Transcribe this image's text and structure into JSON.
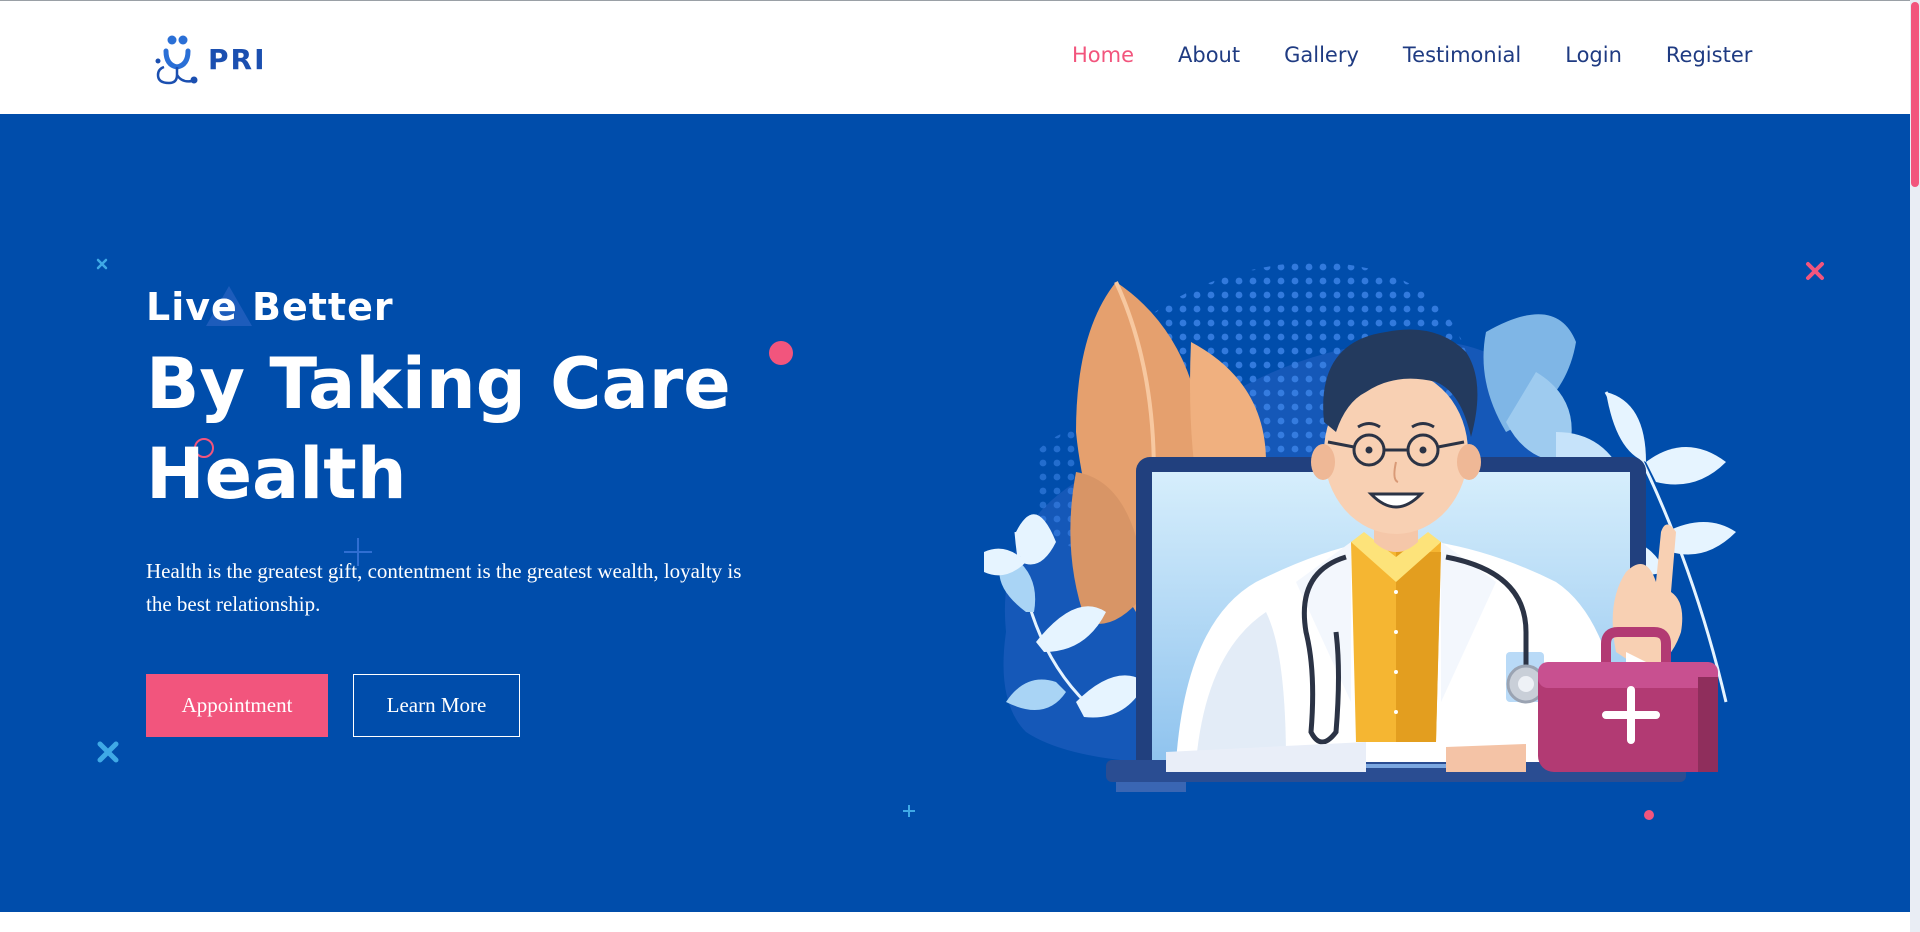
{
  "brand": {
    "name": "PRI",
    "logo_icon": "doctor-stethoscope-logo",
    "color": "#1b4fb0"
  },
  "nav": {
    "items": [
      {
        "label": "Home",
        "active": true
      },
      {
        "label": "About",
        "active": false
      },
      {
        "label": "Gallery",
        "active": false
      },
      {
        "label": "Testimonial",
        "active": false
      },
      {
        "label": "Login",
        "active": false
      },
      {
        "label": "Register",
        "active": false
      }
    ],
    "color": "#1f3b82",
    "active_color": "#f2557d"
  },
  "hero": {
    "eyebrow": "Live Better",
    "headline_line1": "By Taking Care",
    "headline_line2": "Health",
    "subtext": "Health is the greatest gift, contentment is the greatest wealth, loyalty is the best relationship.",
    "primary_button": "Appointment",
    "secondary_button": "Learn More",
    "background": "#004dab",
    "accent": "#f2557d",
    "illustration": "doctor-laptop-illustration"
  }
}
